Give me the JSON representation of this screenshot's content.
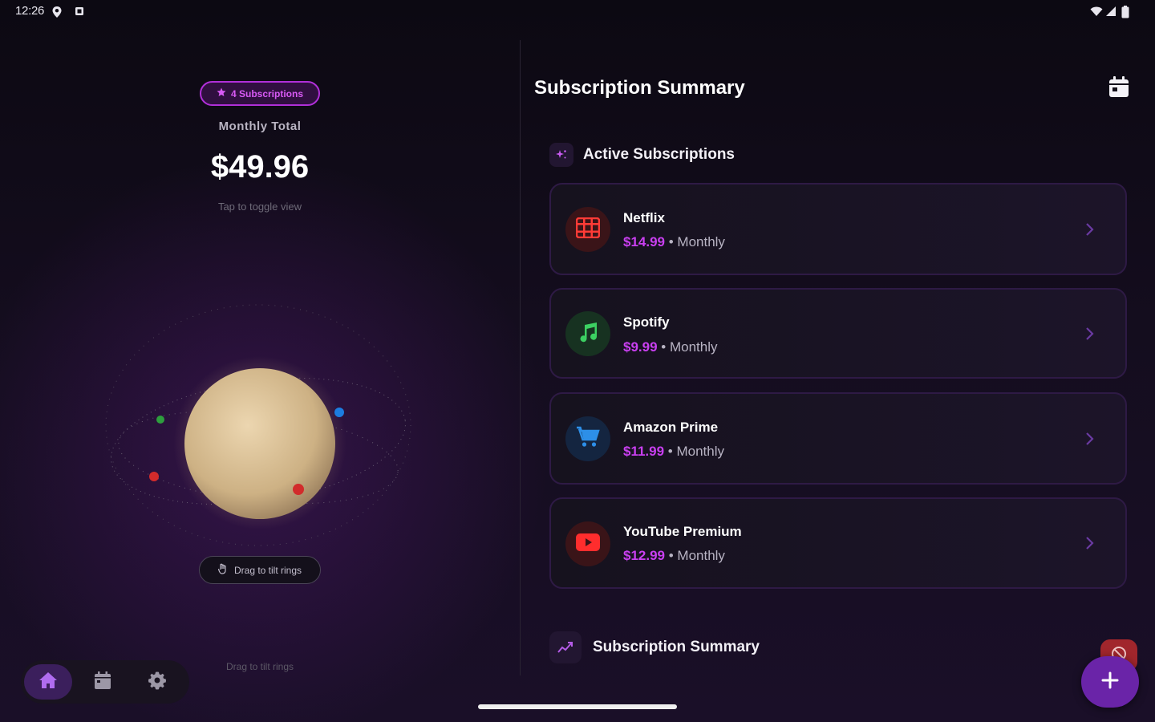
{
  "status_bar": {
    "time": "12:26"
  },
  "left_panel": {
    "subscriptions_pill": "4 Subscriptions",
    "monthly_label": "Monthly Total",
    "monthly_total": "$49.96",
    "toggle_hint": "Tap to toggle view",
    "drag_pill": "Drag to tilt rings",
    "drag_footer": "Drag to tilt rings",
    "planet_dot_colors": [
      "#2e9e3e",
      "#1c7de0",
      "#d22b2b",
      "#d22b2b"
    ]
  },
  "nav": {
    "items": [
      {
        "icon": "home-icon",
        "active": true
      },
      {
        "icon": "calendar-icon",
        "active": false
      },
      {
        "icon": "gear-icon",
        "active": false
      }
    ]
  },
  "right_panel": {
    "title": "Subscription Summary",
    "active_section": "Active Subscriptions",
    "subscriptions": [
      {
        "name": "Netflix",
        "price": "$14.99",
        "separator": " • ",
        "cycle": "Monthly",
        "icon": "film-icon",
        "icon_color": "#e5302c"
      },
      {
        "name": "Spotify",
        "price": "$9.99",
        "separator": " • ",
        "cycle": "Monthly",
        "icon": "music-note-icon",
        "icon_color": "#3cc25e"
      },
      {
        "name": "Amazon Prime",
        "price": "$11.99",
        "separator": " • ",
        "cycle": "Monthly",
        "icon": "cart-icon",
        "icon_color": "#2d8fe8"
      },
      {
        "name": "YouTube Premium",
        "price": "$12.99",
        "separator": " • ",
        "cycle": "Monthly",
        "icon": "play-icon",
        "icon_color": "#e5302c"
      }
    ],
    "summary_section": "Subscription Summary"
  },
  "colors": {
    "accent": "#b02fd8",
    "price": "#c93ff0",
    "fab": "#6a24a8"
  }
}
